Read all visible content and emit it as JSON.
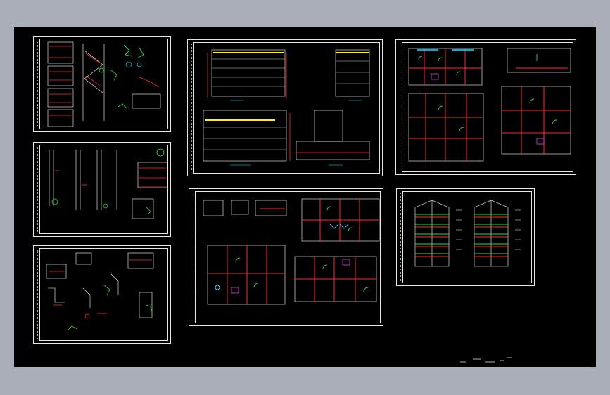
{
  "drawing": {
    "sheets": [
      {
        "id": "stair-details-sheet"
      },
      {
        "id": "section-details-sheet"
      },
      {
        "id": "node-details-sheet"
      },
      {
        "id": "elevations-sheet"
      },
      {
        "id": "floor-plans-sheet"
      },
      {
        "id": "unit-plans-sheet"
      },
      {
        "id": "wall-sections-sheet"
      }
    ],
    "colors": {
      "background": "#000000",
      "workspace": "#a9aeb8",
      "frame": "#e6e6e6",
      "red": "#ff2a2a",
      "green": "#22dd44",
      "cyan": "#22e0ff",
      "yellow": "#ffee22",
      "white": "#ffffff",
      "magenta": "#ff44ff"
    }
  }
}
